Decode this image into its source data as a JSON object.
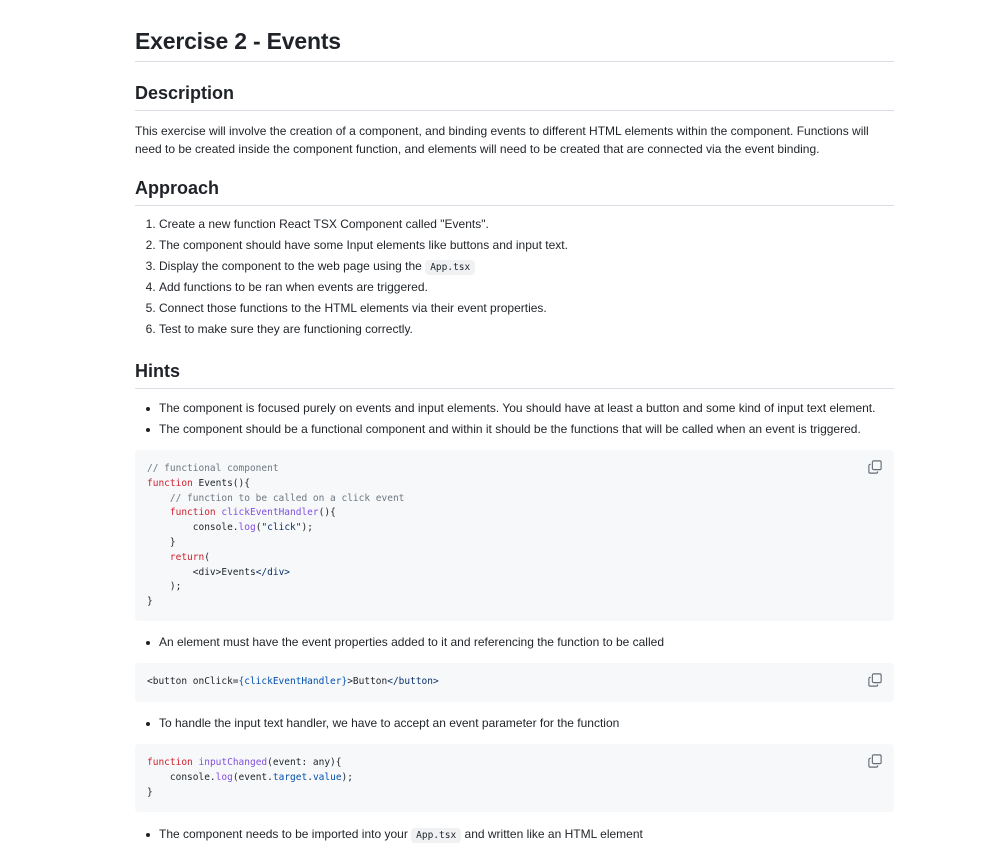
{
  "title": "Exercise 2 - Events",
  "sections": {
    "description": {
      "heading": "Description",
      "text": "This exercise will involve the creation of a component, and binding events to different HTML elements within the component. Functions will need to be created inside the component function, and elements will need to be created that are connected via the event binding."
    },
    "approach": {
      "heading": "Approach",
      "steps": [
        "Create a new function React TSX Component called \"Events\".",
        "The component should have some Input elements like buttons and input text.",
        "Display the component to the web page using the ",
        "Add functions to be ran when events are triggered.",
        "Connect those functions to the HTML elements via their event properties.",
        "Test to make sure they are functioning correctly."
      ],
      "step3_code": "App.tsx"
    },
    "hints": {
      "heading": "Hints",
      "bullets": [
        "The component is focused purely on events and input elements. You should have at least a button and some kind of input text element.",
        "The component should be a functional component and within it should be the functions that will be called when an event is triggered.",
        "An element must have the event properties added to it and referencing the function to be called",
        "To handle the input text handler, we have to accept an event parameter for the function",
        "The component needs to be imported into your ",
        " and written like an HTML element"
      ],
      "bullet5_code": "App.tsx"
    }
  },
  "code": {
    "block1": {
      "l1": "// functional component",
      "l2_kw": "function",
      "l2_rest": " Events(){",
      "l3": "// function to be called on a click event",
      "l4_kw": "function",
      "l4_fn": "clickEventHandler",
      "l4_rest": "(){",
      "l5_a": "console.",
      "l5_fn": "log",
      "l5_b": "(",
      "l5_str": "\"click\"",
      "l5_c": ");",
      "l6": "}",
      "l7_kw": "return",
      "l7_rest": "(",
      "l8_a": "<div>Events",
      "l8_b": "</div>",
      "l9": ");",
      "l10": "}"
    },
    "block2": {
      "a": "<button onClick=",
      "b": "{clickEventHandler}",
      "c": ">Button",
      "d": "</button>",
      "e": ">"
    },
    "block3": {
      "l1_kw": "function",
      "l1_fn": "inputChanged",
      "l1_rest": "(event: any){",
      "l2_a": "console.",
      "l2_fn": "log",
      "l2_b": "(event.",
      "l2_prop1": "target",
      "l2_c": ".",
      "l2_prop2": "value",
      "l2_d": ");",
      "l3": "}"
    }
  },
  "icons": {
    "copy": "copy-icon"
  },
  "colors": {
    "keyword": "#cf222e",
    "function": "#8250df",
    "comment": "#6e7781",
    "string": "#0a3069",
    "property": "#0550ae",
    "code_bg": "#f6f8fa"
  }
}
